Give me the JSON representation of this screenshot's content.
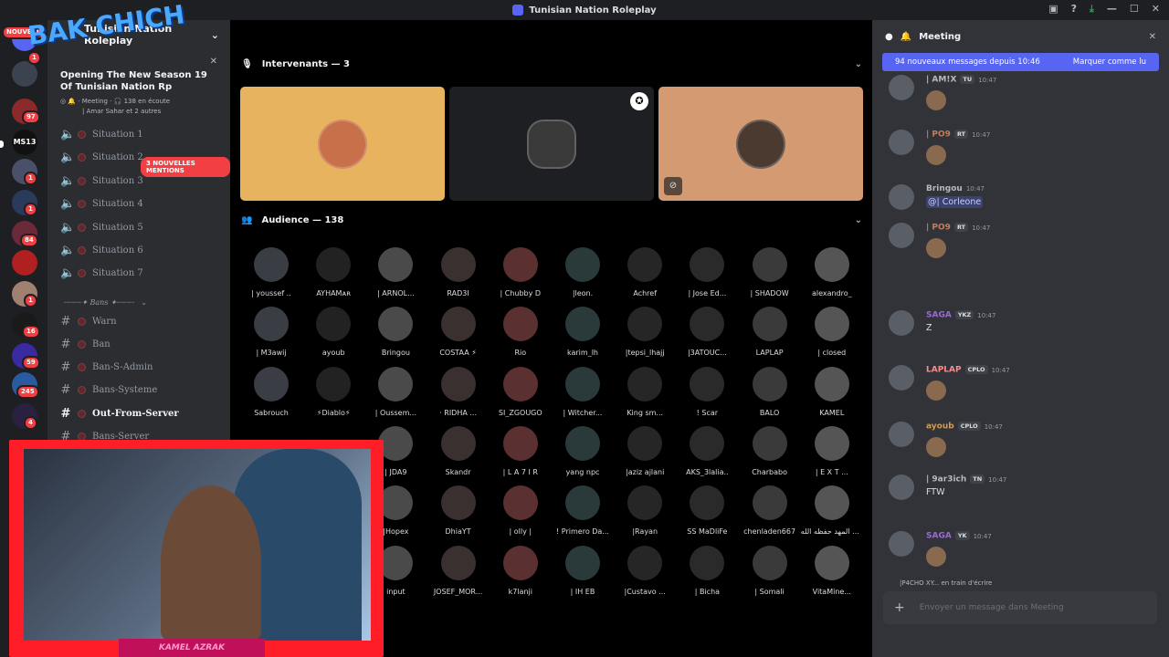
{
  "window": {
    "title": "Tunisian Nation Roleplay"
  },
  "sidebar": {
    "server_name": "Tunisian Nation Roleplay",
    "event_title": "Opening The New Season 19 Of Tunisian Nation Rp",
    "event_channel": "Meeting",
    "event_listeners": "138 en écoute",
    "event_participants": "| Amar Sahar et 2 autres",
    "mentions_badge": "3 NOUVELLES MENTIONS",
    "category_bans": "┈┈┈┈✦ Bans ✦┈┈┈┈",
    "voice_channels": [
      "Situation 1",
      "Situation 2",
      "Situation 3",
      "Situation 4",
      "Situation 5",
      "Situation 6",
      "Situation 7"
    ],
    "text_channels": [
      "Warn",
      "Ban",
      "Ban-S-Admin",
      "Bans-Systeme",
      "Out-From-Server",
      "Bans-Server"
    ]
  },
  "guild_badges": [
    "1",
    "97",
    "1",
    "1",
    "84",
    "1",
    "16",
    "59",
    "245",
    "4"
  ],
  "guild_labels": {
    "new": "NOUVEAU",
    "ms": "MS13"
  },
  "stage": {
    "speakers_header": "Intervenants — 3",
    "audience_header": "Audience — 138",
    "audience": [
      "| youssef ..",
      "AYHAMᴀʀ",
      "| ARNOL...",
      "RAD3I",
      "| Chubby D",
      "|leon.",
      "Achref",
      "| Jose Ed...",
      "| SHADOW",
      "alexandro_",
      "| M3awij",
      "ayoub",
      "Bringou",
      "COSTAA ⚡",
      "Rio",
      "karim_lh",
      "|tepsi_lhajj",
      "|3ATOUC...",
      "LAPLAP",
      "| closed",
      "Sabrouch",
      "⚡Diablo⚡",
      "| Oussem...",
      "· RIDHA ...",
      "SI_ZGOUGO",
      "| Witcher...",
      "King sm...",
      "! Scar",
      "BALO",
      "KAMEL",
      "",
      "",
      "| JDA9",
      "Skandr",
      "| L A 7 I R",
      "yang npc",
      "|aziz ajlani",
      "AKS_3lalia..",
      "Charbabo",
      "| E X T ...",
      "",
      "",
      "|Hopex",
      "DhiaYT",
      "| olly |",
      "! Primero Da...",
      "|Rayan",
      "SS MaDliFe",
      "chenladen667",
      "وأي المهد حفظه الله",
      "",
      "",
      "input",
      "JOSEF_MOR...",
      "k7lanji",
      "| IH EB",
      "|Custavo ...",
      "| Bicha",
      "| Somali",
      "VitaMine..."
    ]
  },
  "stream": {
    "nameplate": "KAMEL AZRAK",
    "logo": "BAK CHICH"
  },
  "chat": {
    "channel_title": "Meeting",
    "new_messages": "94 nouveaux messages depuis 10:46",
    "mark_read": "Marquer comme lu",
    "messages": [
      {
        "author": "| AM!X",
        "tag": "TU",
        "time": "10:47",
        "body": ""
      },
      {
        "author": "| PO9",
        "tag": "RT",
        "time": "10:47",
        "body": ""
      },
      {
        "author": "Bringou",
        "tag": "",
        "time": "10:47",
        "body": "@| Corleone"
      },
      {
        "author": "| PO9",
        "tag": "RT",
        "time": "10:47",
        "body": ""
      },
      {
        "author": "SAGA",
        "tag": "YKZ",
        "time": "10:47",
        "body": "Z"
      },
      {
        "author": "LAPLAP",
        "tag": "CPLO",
        "time": "10:47",
        "body": ""
      },
      {
        "author": "ayoub",
        "tag": "CPLO",
        "time": "10:47",
        "body": ""
      },
      {
        "author": "| 9ar3ich",
        "tag": "TN",
        "time": "10:47",
        "body": "FTW"
      },
      {
        "author": "SAGA",
        "tag": "YK",
        "time": "10:47",
        "body": ""
      }
    ],
    "typing": "|P4CHO XY... en train d'écrire",
    "composer_placeholder": "Envoyer un message dans Meeting"
  }
}
